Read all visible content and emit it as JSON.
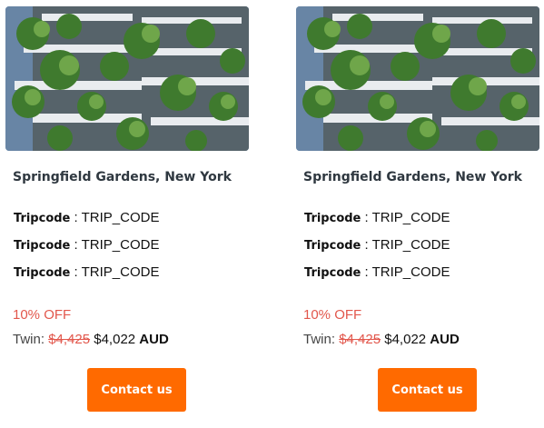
{
  "cards": [
    {
      "title": "Springfield Gardens, New York",
      "meta": [
        {
          "label": "Tripcode",
          "sep": " : ",
          "value": "TRIP_CODE"
        },
        {
          "label": "Tripcode",
          "sep": " : ",
          "value": "TRIP_CODE"
        },
        {
          "label": "Tripcode",
          "sep": " : ",
          "value": "TRIP_CODE"
        }
      ],
      "discount": "10% OFF",
      "price": {
        "label": "Twin: ",
        "old": "$4,425",
        "new": " $4,022 ",
        "currency": "AUD"
      },
      "button": "Contact us"
    },
    {
      "title": "Springfield Gardens, New York",
      "meta": [
        {
          "label": "Tripcode",
          "sep": " : ",
          "value": "TRIP_CODE"
        },
        {
          "label": "Tripcode",
          "sep": " : ",
          "value": "TRIP_CODE"
        },
        {
          "label": "Tripcode",
          "sep": " : ",
          "value": "TRIP_CODE"
        }
      ],
      "discount": "10% OFF",
      "price": {
        "label": "Twin: ",
        "old": "$4,425",
        "new": " $4,022 ",
        "currency": "AUD"
      },
      "button": "Contact us"
    }
  ],
  "colors": {
    "accent": "#ff6a00",
    "discount": "#e2574c",
    "title": "#2f3840"
  }
}
